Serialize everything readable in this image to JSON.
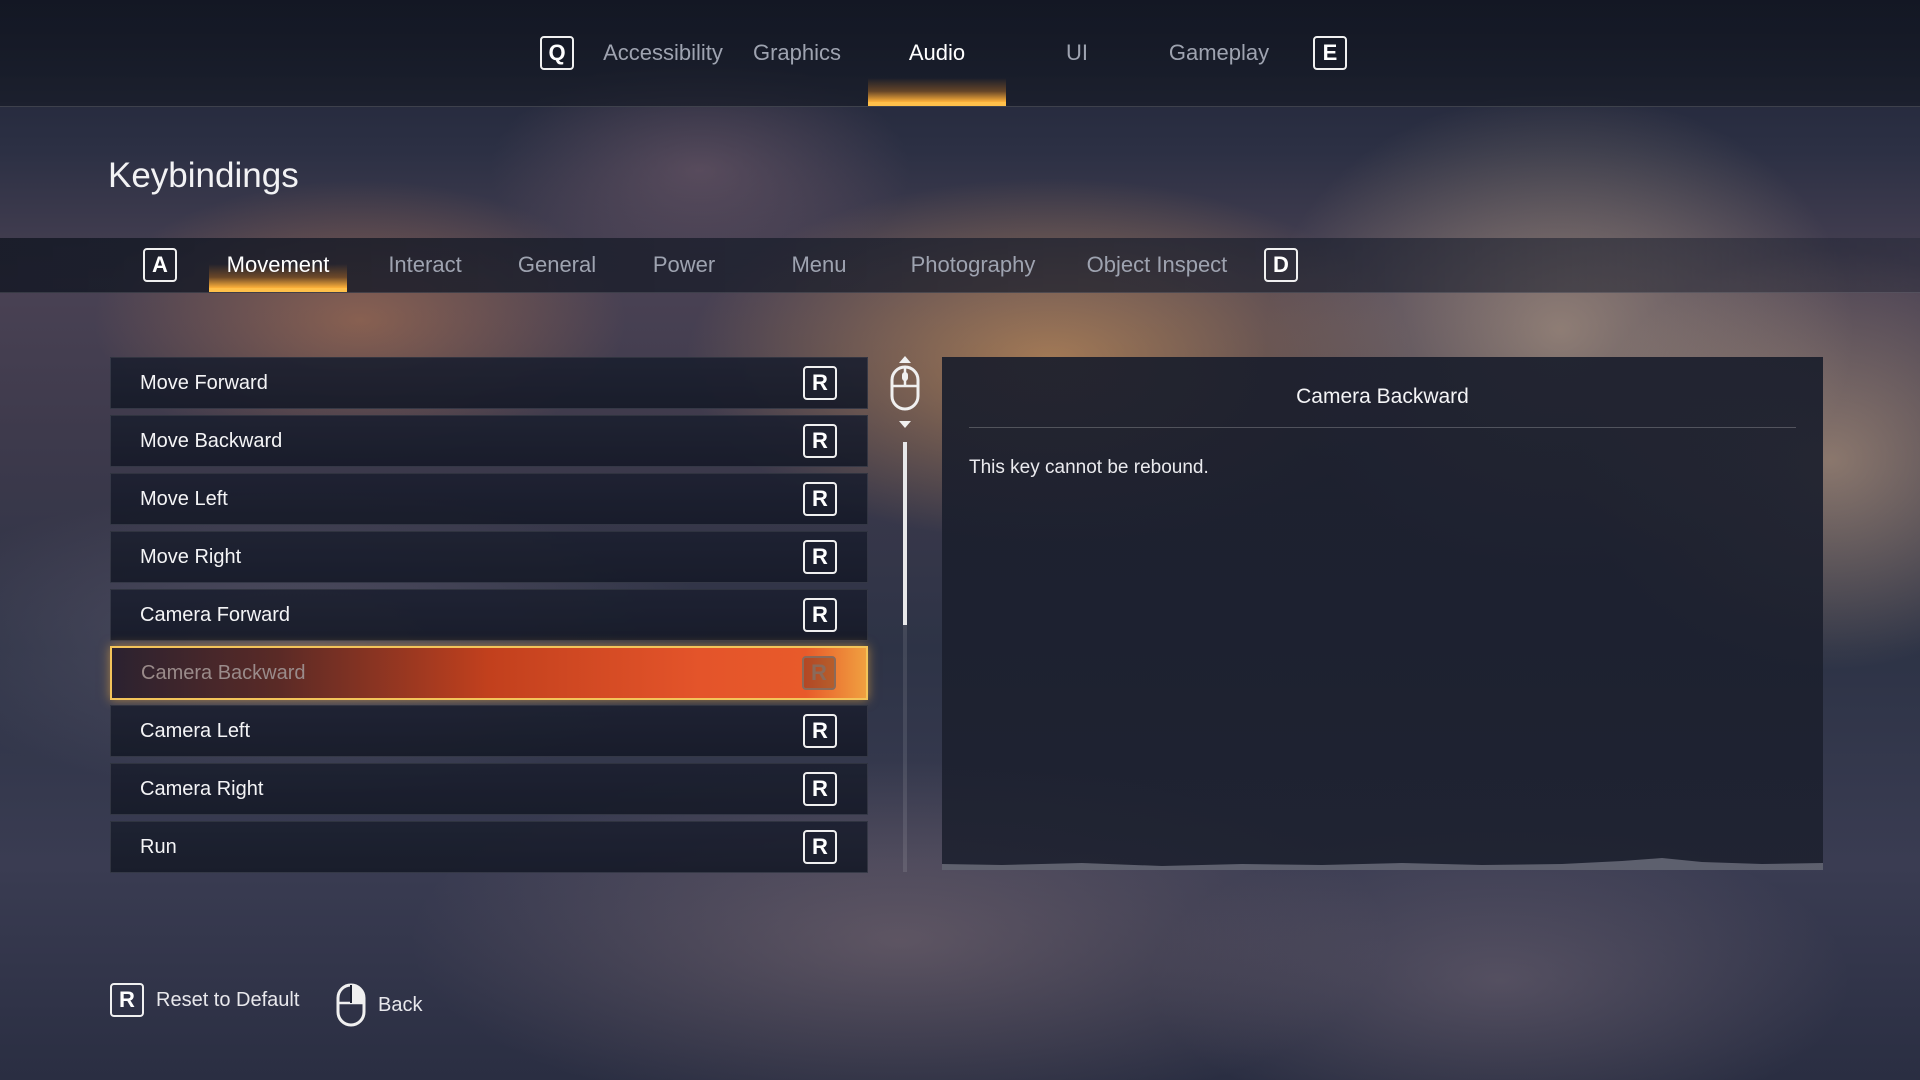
{
  "top_tabs": {
    "prev_key": "Q",
    "next_key": "E",
    "items": [
      {
        "label": "Accessibility",
        "active": false
      },
      {
        "label": "Graphics",
        "active": false
      },
      {
        "label": "Audio",
        "active": true
      },
      {
        "label": "UI",
        "active": false
      },
      {
        "label": "Gameplay",
        "active": false
      }
    ]
  },
  "page": {
    "title": "Keybindings"
  },
  "sub_tabs": {
    "prev_key": "A",
    "next_key": "D",
    "items": [
      {
        "label": "Movement",
        "active": true
      },
      {
        "label": "Interact",
        "active": false
      },
      {
        "label": "General",
        "active": false
      },
      {
        "label": "Power",
        "active": false
      },
      {
        "label": "Menu",
        "active": false
      },
      {
        "label": "Photography",
        "active": false
      },
      {
        "label": "Object Inspect",
        "active": false
      }
    ]
  },
  "bindings": [
    {
      "action": "Move Forward",
      "key": "R",
      "selected": false
    },
    {
      "action": "Move Backward",
      "key": "R",
      "selected": false
    },
    {
      "action": "Move Left",
      "key": "R",
      "selected": false
    },
    {
      "action": "Move Right",
      "key": "R",
      "selected": false
    },
    {
      "action": "Camera Forward",
      "key": "R",
      "selected": false
    },
    {
      "action": "Camera Backward",
      "key": "R",
      "selected": true
    },
    {
      "action": "Camera Left",
      "key": "R",
      "selected": false
    },
    {
      "action": "Camera Right",
      "key": "R",
      "selected": false
    },
    {
      "action": "Run",
      "key": "R",
      "selected": false
    }
  ],
  "scrollbar": {
    "position": 0,
    "visible_fraction": 0.43
  },
  "detail_panel": {
    "title": "Camera Backward",
    "description": "This key cannot be rebound."
  },
  "footer": {
    "reset": {
      "key": "R",
      "label": "Reset to Default"
    },
    "back": {
      "label": "Back",
      "icon": "mouse-right-click-icon"
    }
  },
  "colors": {
    "accent_orange": "#e4542a",
    "accent_gold": "#ffc04a"
  }
}
